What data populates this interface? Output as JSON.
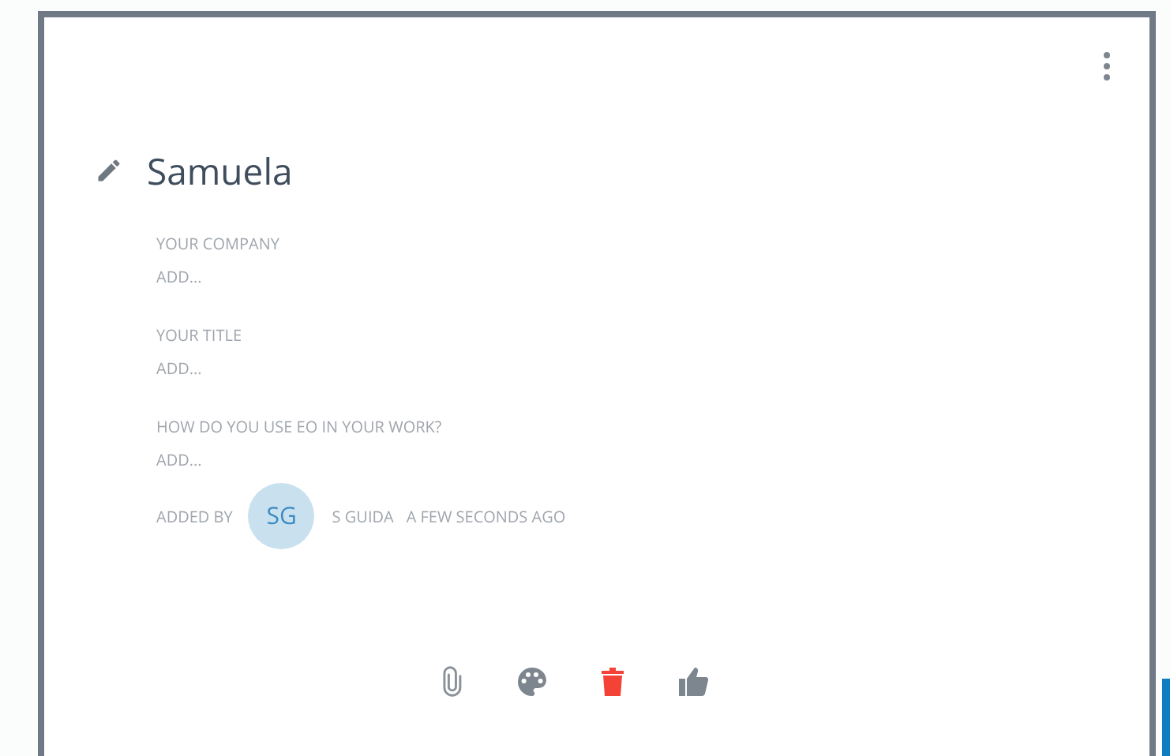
{
  "card": {
    "title": "Samuela",
    "fields": [
      {
        "label": "YOUR COMPANY",
        "placeholder": "ADD..."
      },
      {
        "label": "YOUR TITLE",
        "placeholder": "ADD..."
      },
      {
        "label": "HOW DO YOU USE EO IN YOUR WORK?",
        "placeholder": "ADD..."
      }
    ],
    "added_by": {
      "label": "ADDED BY",
      "initials": "SG",
      "name": "S GUIDA",
      "time": "A FEW SECONDS AGO"
    },
    "actions": [
      {
        "kind": "attach"
      },
      {
        "kind": "palette"
      },
      {
        "kind": "delete"
      },
      {
        "kind": "like"
      }
    ]
  }
}
